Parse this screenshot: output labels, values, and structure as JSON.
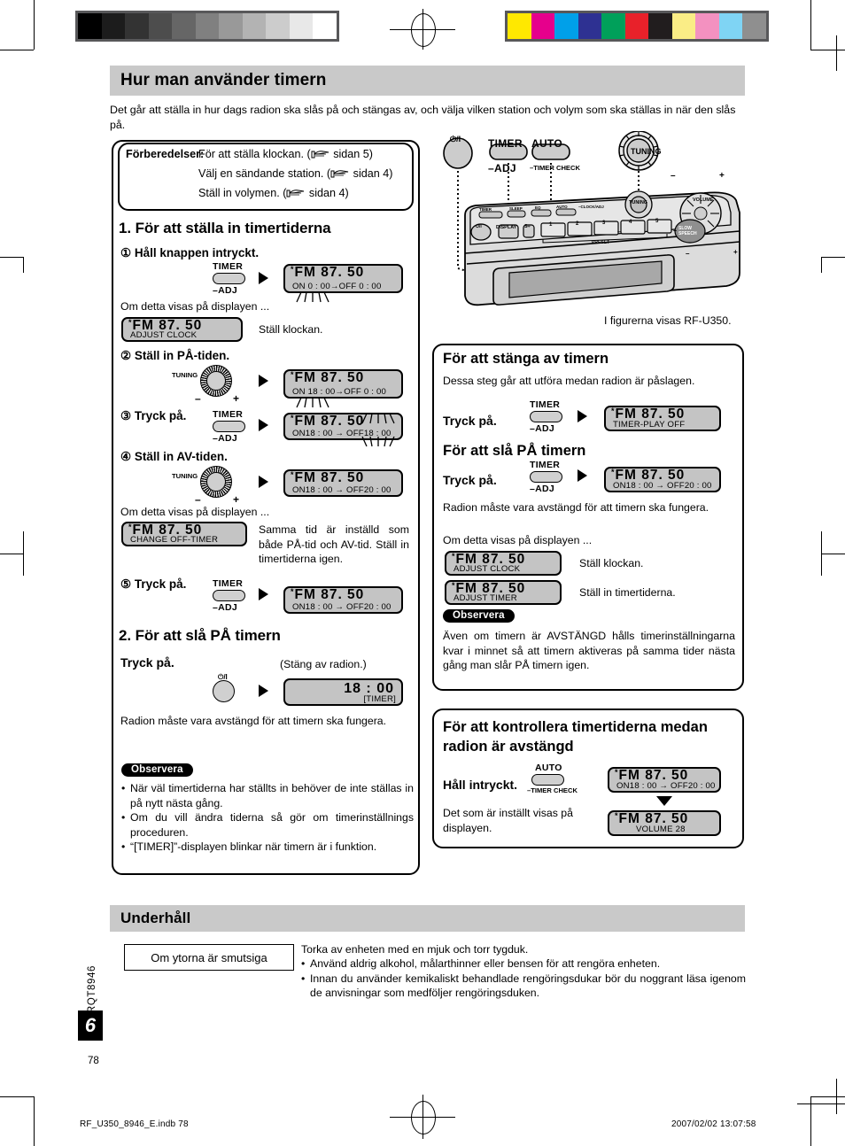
{
  "header": {
    "title": "Hur man använder timern",
    "intro": "Det går att ställa in hur dags radion ska slås på och stängas av, och välja vilken station och volym som ska ställas in när den slås på."
  },
  "prep": {
    "label": "Förberedelser:",
    "items": [
      "För att ställa klockan. (",
      "Välj en sändande station. (",
      "Ställ in volymen. ("
    ],
    "refs": [
      "sidan 5)",
      "sidan 4)",
      "sidan 4)"
    ]
  },
  "section1": {
    "title": "1. För att ställa in timertiderna",
    "step1": {
      "label": "① Håll knappen intryckt.",
      "button": {
        "top": "TIMER",
        "bottom": "–ADJ"
      },
      "lcd": {
        "line1": "FM  87. 50",
        "on": "ON  0 : 00",
        "arrow": "→",
        "off": "OFF  0 : 00"
      },
      "note": "Om detta visas på displayen ...",
      "note_lcd": {
        "line1": "FM  87. 50",
        "line2": "ADJUST CLOCK"
      },
      "note_text": "Ställ klockan."
    },
    "step2": {
      "label": "② Ställ in PÅ-tiden.",
      "knob": "TUNING",
      "lcd": {
        "line1": "FM  87. 50",
        "on": "ON 18 : 00",
        "arrow": "→",
        "off": "OFF  0 : 00"
      }
    },
    "step3": {
      "label": "③ Tryck på.",
      "button": {
        "top": "TIMER",
        "bottom": "–ADJ"
      },
      "lcd": {
        "line1": "FM  87. 50",
        "line2": "ON18 : 00 → OFF18 : 00"
      }
    },
    "step4": {
      "label": "④ Ställ in AV-tiden.",
      "knob": "TUNING",
      "lcd": {
        "line1": "FM  87. 50",
        "line2": "ON18 : 00 → OFF20 : 00"
      },
      "note": "Om detta visas på displayen ...",
      "note_lcd": {
        "line1": "FM  87. 50",
        "line2": "CHANGE  OFF-TIMER"
      },
      "note_text": "Samma tid är inställd som både PÅ-tid och AV-tid. Ställ in timertiderna igen."
    },
    "step5": {
      "label": "⑤ Tryck på.",
      "button": {
        "top": "TIMER",
        "bottom": "–ADJ"
      },
      "lcd": {
        "line1": "FM  87. 50",
        "line2": "ON18 : 00 → OFF20 : 00"
      }
    }
  },
  "section2": {
    "title": "2. För att slå PÅ timern",
    "press": "Tryck på.",
    "power_icon": "⏻/I",
    "caption": "(Stäng av radion.)",
    "lcd": {
      "big": "18 : 00",
      "line2": "[TIMER]"
    },
    "body": "Radion måste vara avstängd för att timern ska fungera.",
    "observera": "Observera",
    "bullets": [
      "När väl timertiderna har ställts in behöver de inte ställas in på nytt nästa gång.",
      "Om du vill ändra tiderna så gör om timerinställnings proceduren.",
      "“[TIMER]”-displayen blinkar när timern är i funktion."
    ]
  },
  "device": {
    "power": "⏻/I",
    "timer_top": "TIMER",
    "timer_bottom": "–ADJ",
    "auto_top": "AUTO",
    "auto_bottom": "–TIMER CHECK",
    "tuning": "TUNING",
    "panel": {
      "timer": "TIMER",
      "sleep": "SLEEP",
      "eq": "EQ",
      "auto": "AUTO",
      "clock": "–CLOCK/ADJ",
      "tuning": "TUNING",
      "volume": "VOLUME",
      "power": "⏻/I",
      "display": "DISPLAY",
      "splus": "S÷",
      "presets": [
        "1",
        "2",
        "3",
        "4",
        "5"
      ],
      "preset_label": "PRESET",
      "slow_speech": "SLOW\nSPEECH"
    },
    "caption": "I figurerna visas RF-U350."
  },
  "turnoff": {
    "title": "För att stänga av timern",
    "lead": "Dessa steg går att utföra medan radion är påslagen.",
    "press": "Tryck på.",
    "button": {
      "top": "TIMER",
      "bottom": "–ADJ"
    },
    "lcd": {
      "line1": "FM  87. 50",
      "line2": "TIMER-PLAY  OFF"
    }
  },
  "turnon": {
    "title": "För att slå PÅ timern",
    "press": "Tryck på.",
    "button": {
      "top": "TIMER",
      "bottom": "–ADJ"
    },
    "lcd": {
      "line1": "FM  87. 50",
      "line2": "ON18 : 00 → OFF20 : 00"
    },
    "body": "Radion måste vara avstängd för att timern ska fungera.",
    "note": "Om detta visas på displayen ...",
    "lcd_clock": {
      "line1": "FM  87. 50",
      "line2": "ADJUST CLOCK"
    },
    "text_clock": "Ställ klockan.",
    "lcd_timer": {
      "line1": "FM  87. 50",
      "line2": "ADJUST  TIMER"
    },
    "text_timer": "Ställ in timertiderna.",
    "observera": "Observera",
    "obs_text": "Även om timern är AVSTÄNGD hålls timerinställningarna kvar i minnet så att timern aktiveras på samma tider nästa gång man slår PÅ timern igen."
  },
  "check": {
    "title": "För att kontrollera timertiderna medan radion är avstängd",
    "hold": "Håll intryckt.",
    "button": {
      "top": "AUTO",
      "bottom": "–TIMER CHECK"
    },
    "lcd1": {
      "line1": "FM  87. 50",
      "line2": "ON18 : 00 → OFF20 : 00"
    },
    "lcd2": {
      "line1": "FM  87. 50",
      "line2": "VOLUME 28"
    },
    "body": "Det som är inställt visas på displayen."
  },
  "maintenance": {
    "title": "Underhåll",
    "box_label": "Om ytorna är smutsiga",
    "lead": "Torka av enheten med en mjuk och torr tygduk.",
    "bullets": [
      "Använd aldrig alkohol, målarthinner eller bensen för att rengöra enheten.",
      "Innan du använder kemikaliskt behandlade rengöringsdukar bör du noggrant läsa igenom de anvisningar som medföljer rengöringsduken."
    ]
  },
  "footer": {
    "spine_code": "RQT8946",
    "page_badge": "6",
    "folio": "78",
    "left": "RF_U350_8946_E.indb    78",
    "right": "2007/02/02    13:07:58"
  },
  "colors": {
    "grayscale": [
      "#000000",
      "#1c1c1c",
      "#333333",
      "#4d4d4d",
      "#666666",
      "#808080",
      "#999999",
      "#b3b3b3",
      "#cccccc",
      "#e8e8e8",
      "#ffffff"
    ],
    "colorbar": [
      "#ffe800",
      "#e6008c",
      "#00a0e9",
      "#2e3192",
      "#00a05a",
      "#e8212a",
      "#211d1e",
      "#faed86",
      "#f391c0",
      "#7fd4f4",
      "#8f8f8f"
    ],
    "header_bg": "#c9c9c9",
    "lcd_bg": "#c4c4c4"
  }
}
